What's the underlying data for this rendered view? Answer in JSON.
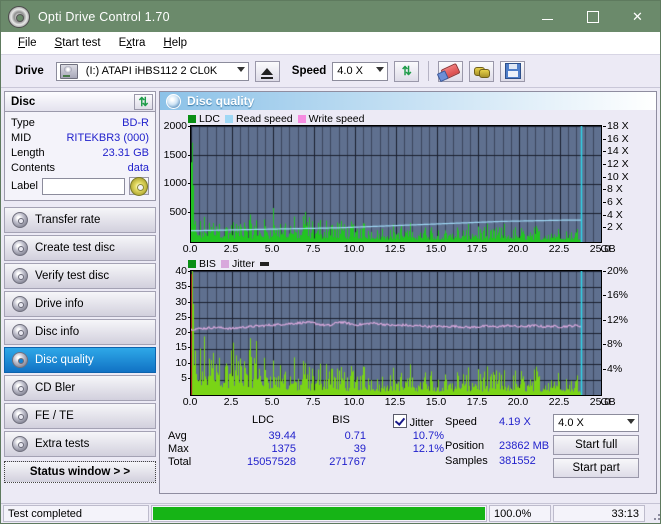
{
  "window": {
    "title": "Opti Drive Control 1.70",
    "icon": "disc-icon",
    "minimize": "minimize-icon",
    "maximize": "maximize-icon",
    "close": "close-icon"
  },
  "menu": {
    "items": [
      {
        "label": "File",
        "accel": "F"
      },
      {
        "label": "Start test",
        "accel": "S"
      },
      {
        "label": "Extra",
        "accel": "x"
      },
      {
        "label": "Help",
        "accel": "H"
      }
    ]
  },
  "toolbar": {
    "drive_label": "Drive",
    "drive_value": "(I:)   ATAPI iHBS112  2 CL0K",
    "eject_label": "eject-button",
    "speed_label": "Speed",
    "speed_value": "4.0 X",
    "icons": [
      "refresh-icon",
      "eraser-icon",
      "plug-icon",
      "save-icon"
    ]
  },
  "disc": {
    "title": "Disc",
    "refresh": "refresh-icon",
    "rows": [
      {
        "key": "Type",
        "value": "BD-R"
      },
      {
        "key": "MID",
        "value": "RITEKBR3 (000)"
      },
      {
        "key": "Length",
        "value": "23.31 GB"
      },
      {
        "key": "Contents",
        "value": "data"
      }
    ],
    "label_key": "Label",
    "label_value": ""
  },
  "nav": {
    "items": [
      {
        "label": "Transfer rate",
        "selected": false
      },
      {
        "label": "Create test disc",
        "selected": false
      },
      {
        "label": "Verify test disc",
        "selected": false
      },
      {
        "label": "Drive info",
        "selected": false
      },
      {
        "label": "Disc info",
        "selected": false
      },
      {
        "label": "Disc quality",
        "selected": true
      },
      {
        "label": "CD Bler",
        "selected": false
      },
      {
        "label": "FE / TE",
        "selected": false
      },
      {
        "label": "Extra tests",
        "selected": false
      }
    ],
    "status_window": "Status window > >"
  },
  "panel": {
    "title": "Disc quality",
    "icon": "disc-quality-icon"
  },
  "stats": {
    "columns": [
      "LDC",
      "BIS"
    ],
    "jitter_label": "Jitter",
    "jitter_checked": true,
    "rows": [
      {
        "key": "Avg",
        "ldc": "39.44",
        "bis": "0.71",
        "jitter": "10.7%"
      },
      {
        "key": "Max",
        "ldc": "1375",
        "bis": "39",
        "jitter": "12.1%"
      },
      {
        "key": "Total",
        "ldc": "15057528",
        "bis": "271767",
        "jitter": ""
      }
    ]
  },
  "readout": {
    "speed_key": "Speed",
    "speed_value": "4.19 X",
    "position_key": "Position",
    "position_value": "23862 MB",
    "samples_key": "Samples",
    "samples_value": "381552",
    "speed_select": "4.0 X",
    "start_full": "Start full",
    "start_part": "Start part"
  },
  "statusbar": {
    "message": "Test completed",
    "percent_label": "100.0%",
    "percent_value": 100,
    "elapsed": "33:13"
  },
  "chart_data": [
    {
      "type": "area",
      "name": "ldc-chart",
      "title": "",
      "xlabel": "GB",
      "ylabel": "",
      "xlim": [
        0,
        25
      ],
      "ylim": [
        0,
        2000
      ],
      "y2lim": [
        0,
        18
      ],
      "xticks": [
        "0.0",
        "2.5",
        "5.0",
        "7.5",
        "10.0",
        "12.5",
        "15.0",
        "17.5",
        "20.0",
        "22.5",
        "25.0"
      ],
      "yticks": [
        "2000",
        "1500",
        "1000",
        "500"
      ],
      "y2ticks": [
        "18 X",
        "16 X",
        "14 X",
        "12 X",
        "10 X",
        "8 X",
        "6 X",
        "4 X",
        "2 X"
      ],
      "grid": true,
      "legend": [
        {
          "name": "LDC",
          "color": "#0a8f15"
        },
        {
          "name": "Read speed",
          "color": "#9fd8f5"
        },
        {
          "name": "Write speed",
          "color": "#f58ce0"
        }
      ],
      "marker_x": 23.8,
      "marker_color": "#2fd4e8",
      "series": [
        {
          "name": "LDC",
          "color": "#22c422",
          "kind": "spikes",
          "x": [
            0.0,
            0.25,
            0.5,
            0.75,
            1.0,
            1.25,
            1.5,
            1.75,
            2.0,
            2.25,
            2.5,
            2.75,
            3.0,
            3.25,
            3.5,
            3.75,
            4.0,
            4.25,
            4.5,
            4.75,
            5.0,
            5.25,
            5.5,
            5.75,
            6.0,
            6.25,
            6.5,
            6.75,
            7.0,
            7.25,
            7.5,
            7.75,
            8.0,
            8.25,
            8.5,
            8.75,
            9.0,
            9.25,
            9.5,
            9.75,
            10.0,
            10.5,
            11.0,
            11.5,
            12.0,
            12.5,
            13.0,
            13.5,
            14.0,
            14.5,
            15.0,
            15.5,
            16.0,
            16.5,
            17.0,
            17.5,
            18.0,
            18.5,
            19.0,
            19.5,
            20.0,
            20.5,
            21.0,
            21.5,
            22.0,
            22.5,
            23.0,
            23.5,
            23.8
          ],
          "y": [
            1375,
            220,
            200,
            210,
            300,
            240,
            330,
            280,
            230,
            200,
            250,
            220,
            210,
            340,
            260,
            230,
            250,
            200,
            240,
            210,
            420,
            230,
            210,
            260,
            240,
            210,
            230,
            200,
            380,
            220,
            200,
            240,
            210,
            260,
            300,
            230,
            200,
            240,
            220,
            190,
            200,
            210,
            180,
            170,
            160,
            180,
            170,
            150,
            160,
            150,
            170,
            150,
            160,
            140,
            150,
            160,
            140,
            150,
            160,
            140,
            150,
            140,
            150,
            140,
            150,
            160,
            150,
            140,
            120
          ]
        },
        {
          "name": "Read speed",
          "color": "#9fd8f5",
          "kind": "line",
          "axis": "y2",
          "x": [
            0.0,
            1.0,
            2.0,
            3.0,
            4.0,
            5.0,
            6.0,
            7.0,
            8.0,
            9.0,
            10.0,
            11.0,
            12.0,
            13.0,
            14.0,
            15.0,
            16.0,
            17.0,
            18.0,
            19.0,
            20.0,
            21.0,
            22.0,
            23.0,
            23.8
          ],
          "y": [
            1.75,
            1.8,
            1.85,
            1.9,
            1.95,
            2.0,
            2.05,
            2.1,
            2.15,
            2.2,
            2.3,
            2.4,
            2.5,
            2.6,
            2.7,
            2.8,
            2.9,
            3.0,
            3.1,
            3.2,
            3.25,
            3.3,
            3.35,
            3.4,
            3.4
          ]
        },
        {
          "name": "Write speed",
          "color": "#f58ce0",
          "kind": "line",
          "x": [],
          "y": []
        }
      ]
    },
    {
      "type": "area",
      "name": "bis-jitter-chart",
      "title": "",
      "xlabel": "GB",
      "ylabel": "",
      "xlim": [
        0,
        25
      ],
      "ylim": [
        0,
        40
      ],
      "y2lim": [
        0,
        20
      ],
      "xticks": [
        "0.0",
        "2.5",
        "5.0",
        "7.5",
        "10.0",
        "12.5",
        "15.0",
        "17.5",
        "20.0",
        "22.5",
        "25.0"
      ],
      "yticks": [
        "40",
        "35",
        "30",
        "25",
        "20",
        "15",
        "10",
        "5"
      ],
      "y2ticks": [
        "20%",
        "16%",
        "12%",
        "8%",
        "4%"
      ],
      "grid": true,
      "legend": [
        {
          "name": "BIS",
          "color": "#0a8f15"
        },
        {
          "name": "Jitter",
          "color": "#d8a8dc"
        }
      ],
      "marker_x": 23.8,
      "marker_color": "#2fd4e8",
      "series": [
        {
          "name": "BIS",
          "color": "#7ad416",
          "kind": "spikes",
          "x": [
            0.0,
            0.25,
            0.5,
            0.75,
            1.0,
            1.25,
            1.5,
            1.75,
            2.0,
            2.25,
            2.5,
            2.75,
            3.0,
            3.25,
            3.5,
            3.75,
            4.0,
            4.25,
            4.5,
            4.75,
            5.0,
            5.25,
            5.5,
            5.75,
            6.0,
            6.25,
            6.5,
            6.75,
            7.0,
            7.25,
            7.5,
            7.75,
            8.0,
            8.25,
            8.5,
            8.75,
            9.0,
            9.25,
            9.5,
            9.75,
            10.0,
            10.5,
            11.0,
            11.5,
            12.0,
            12.5,
            13.0,
            13.5,
            14.0,
            14.5,
            15.0,
            15.5,
            16.0,
            16.5,
            17.0,
            17.5,
            18.0,
            18.5,
            19.0,
            19.5,
            20.0,
            20.5,
            21.0,
            21.5,
            22.0,
            22.5,
            23.0,
            23.5,
            23.8
          ],
          "y": [
            39,
            9,
            8,
            10,
            9,
            11,
            12,
            11,
            9,
            8,
            13,
            9,
            8,
            11,
            10,
            9,
            12,
            8,
            7,
            8,
            8,
            6,
            7,
            6,
            5,
            6,
            5,
            6,
            7,
            5,
            5,
            6,
            6,
            7,
            9,
            6,
            5,
            6,
            5,
            5,
            5,
            6,
            5,
            4,
            5,
            5,
            4,
            5,
            4,
            5,
            4,
            5,
            4,
            5,
            4,
            5,
            4,
            5,
            4,
            4,
            5,
            4,
            5,
            4,
            5,
            5,
            4,
            4,
            3
          ]
        },
        {
          "name": "Jitter",
          "color": "#d8a8dc",
          "kind": "line",
          "axis": "y2",
          "x": [
            0.0,
            0.5,
            1.0,
            1.5,
            2.0,
            2.5,
            3.0,
            3.5,
            4.0,
            4.5,
            5.0,
            5.5,
            6.0,
            6.5,
            7.0,
            7.5,
            8.0,
            8.5,
            9.0,
            9.5,
            10.0,
            10.5,
            11.0,
            11.5,
            12.0,
            12.5,
            13.0,
            13.5,
            14.0,
            14.5,
            15.0,
            15.5,
            16.0,
            16.5,
            17.0,
            17.5,
            18.0,
            18.5,
            19.0,
            19.5,
            20.0,
            20.5,
            21.0,
            21.5,
            22.0,
            22.5,
            23.0,
            23.5,
            23.8
          ],
          "y": [
            10.6,
            10.7,
            10.8,
            10.9,
            10.8,
            10.7,
            10.9,
            11.0,
            11.1,
            11.2,
            11.3,
            11.4,
            11.5,
            11.6,
            11.7,
            11.6,
            11.3,
            11.2,
            11.8,
            11.6,
            11.3,
            11.4,
            11.6,
            11.5,
            11.3,
            11.2,
            11.3,
            11.1,
            11.2,
            11.0,
            11.1,
            11.0,
            11.1,
            11.0,
            10.9,
            11.0,
            11.1,
            11.0,
            11.1,
            11.2,
            11.0,
            11.1,
            11.2,
            11.0,
            11.1,
            11.0,
            11.1,
            11.2,
            11.1
          ]
        }
      ]
    }
  ]
}
